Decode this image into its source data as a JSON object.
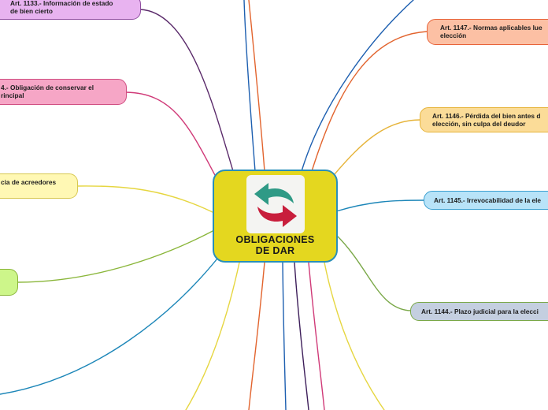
{
  "central_topic": {
    "title": "OBLIGACIONES\nDE DAR",
    "icon": "exchange-arrows-icon"
  },
  "topics": [
    {
      "id": "art-1133",
      "lines": [
        "Art. 1133.- Información de estado",
        "de bien cierto"
      ],
      "fill": "#e8b3f0",
      "border": "#8f4da0"
    },
    {
      "id": "art-1134",
      "lines": [
        "4.- Obligación de conservar el",
        "rincipal"
      ],
      "fill": "#f6a6c6",
      "border": "#d04e82"
    },
    {
      "id": "acreedores",
      "lines": [
        "cia de acreedores"
      ],
      "fill": "#fff8b4",
      "border": "#d8c850"
    },
    {
      "id": "green-node",
      "lines": [
        ""
      ],
      "fill": "#cdf68a",
      "border": "#8ab63a"
    },
    {
      "id": "art-1147",
      "lines": [
        "Art. 1147.- Normas aplicables lue",
        "elección"
      ],
      "fill": "#fcc0a4",
      "border": "#e8643a"
    },
    {
      "id": "art-1146",
      "lines": [
        "Art. 1146.- Pérdida del bien antes d",
        "elección, sin culpa del deudor"
      ],
      "fill": "#fbdc98",
      "border": "#e6b43a"
    },
    {
      "id": "art-1145",
      "lines": [
        "Art. 1145.- Irrevocabilidad de la ele"
      ],
      "fill": "#b8e3f8",
      "border": "#3a9fd0"
    },
    {
      "id": "art-1144",
      "lines": [
        "Art. 1144.- Plazo judicial para la elecci"
      ],
      "fill": "#c4cfe0",
      "border": "#7aa848"
    }
  ],
  "colors": {
    "center_fill": "#e4d71f",
    "center_border": "#2a8fb8",
    "arrow_teal": "#2f9a86",
    "arrow_red": "#c81e3c"
  }
}
